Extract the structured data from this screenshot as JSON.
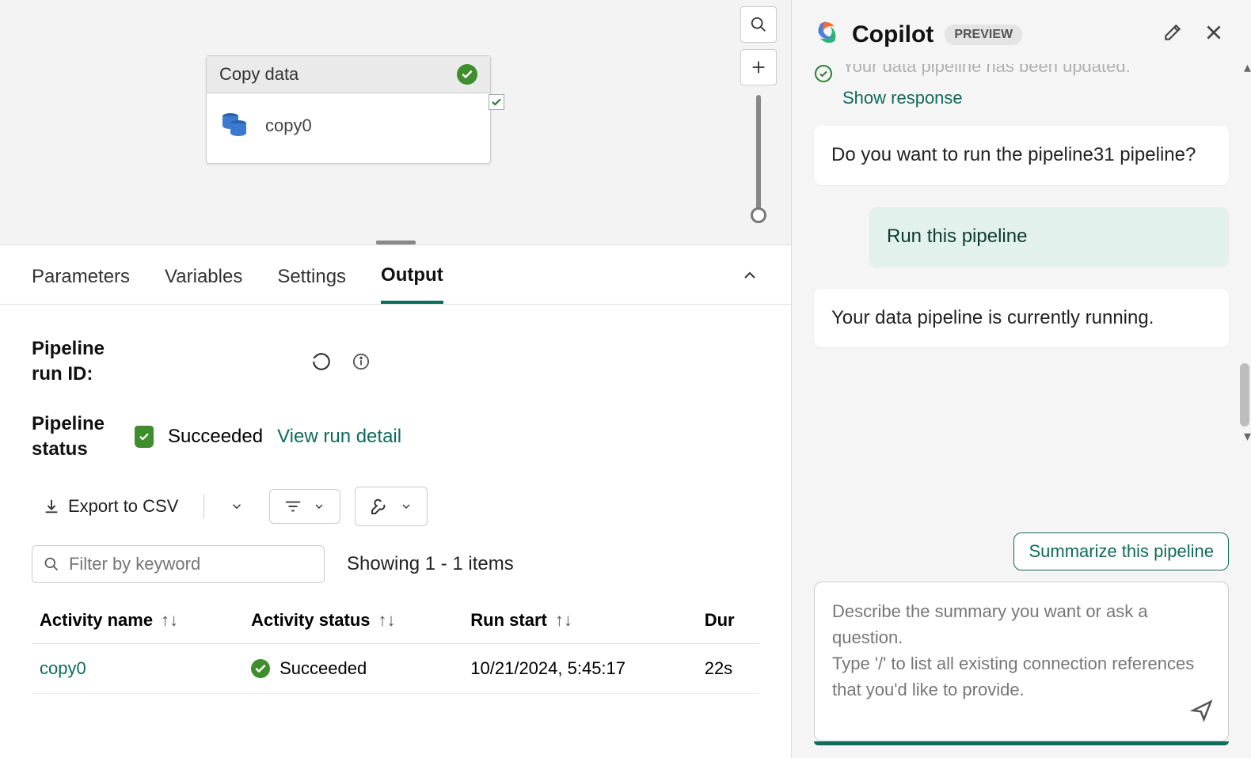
{
  "canvas": {
    "activity": {
      "title": "Copy data",
      "name": "copy0"
    }
  },
  "tabs": {
    "parameters": "Parameters",
    "variables": "Variables",
    "settings": "Settings",
    "output": "Output",
    "active": "output"
  },
  "output": {
    "run_id_label": "Pipeline run ID:",
    "status_label": "Pipeline status",
    "status_value": "Succeeded",
    "view_run_detail": "View run detail",
    "export_csv": "Export to CSV",
    "filter_placeholder": "Filter by keyword",
    "showing_text": "Showing 1 - 1 items",
    "columns": {
      "activity_name": "Activity name",
      "activity_status": "Activity status",
      "run_start": "Run start",
      "duration": "Dur"
    },
    "rows": [
      {
        "name": "copy0",
        "status": "Succeeded",
        "start": "10/21/2024, 5:45:17",
        "duration": "22s"
      }
    ]
  },
  "copilot": {
    "title": "Copilot",
    "preview": "PREVIEW",
    "partial_message": "Your data pipeline has been updated.",
    "show_response": "Show response",
    "messages": [
      {
        "role": "assistant",
        "text": "Do you want to run the pipeline31 pipeline?"
      },
      {
        "role": "user",
        "text": "Run this pipeline"
      },
      {
        "role": "assistant",
        "text": "Your data pipeline is currently running."
      }
    ],
    "suggestion": "Summarize this pipeline",
    "input_placeholder": "Describe the summary you want or ask a question.\nType '/' to list all existing connection references that you'd like to provide."
  }
}
